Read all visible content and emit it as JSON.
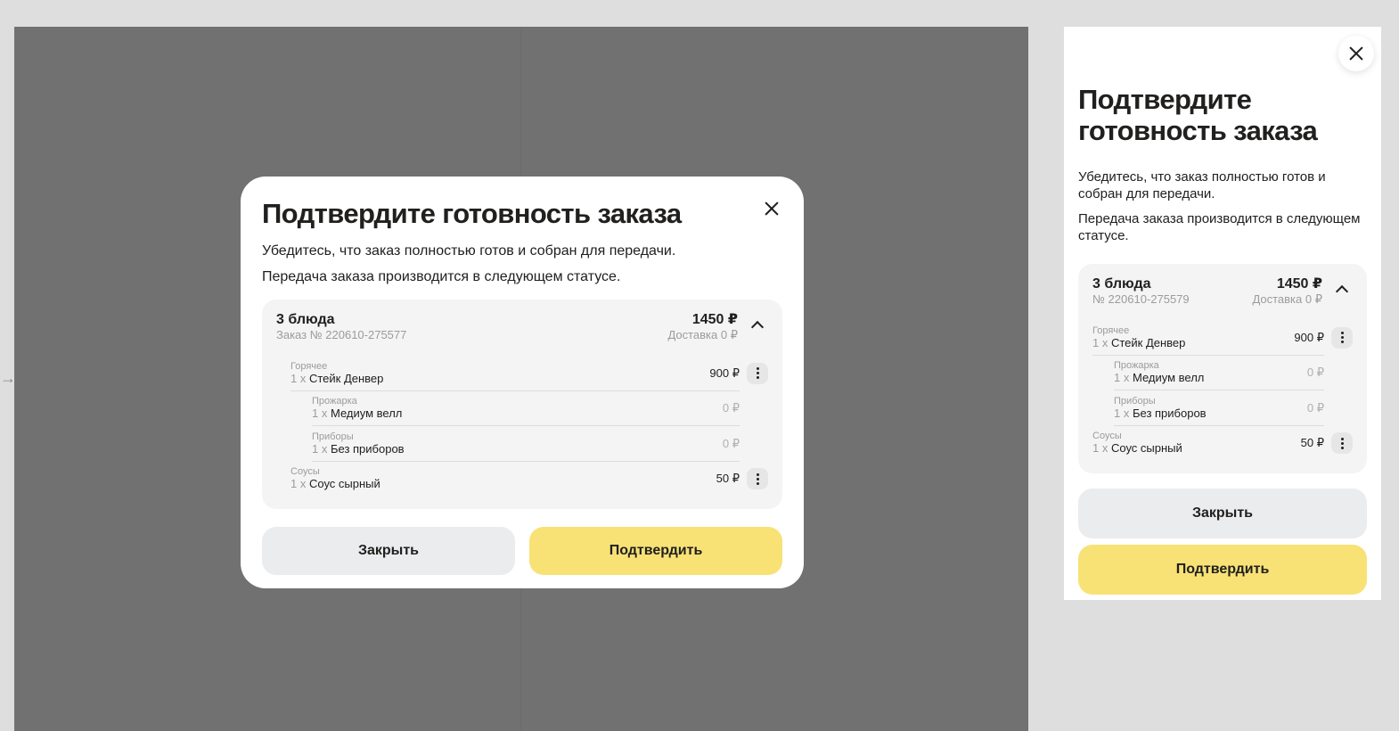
{
  "side_arrow": "→",
  "desktop": {
    "title": "Подтвердите готовность заказа",
    "description_1": "Убедитесь, что заказ полностью готов и собран для передачи.",
    "description_2": "Передача заказа производится в следующем статусе.",
    "order": {
      "dishes_count": "3 блюда",
      "order_number": "Заказ № 220610-275577",
      "total": "1450 ₽",
      "delivery": "Доставка 0 ₽",
      "items": [
        {
          "category": "Горячее",
          "qty": "1 x",
          "name": "Стейк Денвер",
          "price": "900 ₽"
        },
        {
          "category": "Прожарка",
          "qty": "1 x",
          "name": "Медиум велл",
          "price": "0 ₽"
        },
        {
          "category": "Приборы",
          "qty": "1 x",
          "name": "Без приборов",
          "price": "0 ₽"
        },
        {
          "category": "Соусы",
          "qty": "1 x",
          "name": "Соус сырный",
          "price": "50 ₽"
        }
      ]
    },
    "close_label": "Закрыть",
    "confirm_label": "Подтвердить"
  },
  "mobile": {
    "title": "Подтвердите готовность заказа",
    "description_1": "Убедитесь, что заказ полностью готов и собран для передачи.",
    "description_2": "Передача заказа производится в следующем статусе.",
    "order": {
      "dishes_count": "3 блюда",
      "order_number": "№ 220610-275579",
      "total": "1450 ₽",
      "delivery": "Доставка 0 ₽",
      "items": [
        {
          "category": "Горячее",
          "qty": "1 x",
          "name": "Стейк Денвер",
          "price": "900 ₽"
        },
        {
          "category": "Прожарка",
          "qty": "1 x",
          "name": "Медиум велл",
          "price": "0 ₽"
        },
        {
          "category": "Приборы",
          "qty": "1 x",
          "name": "Без приборов",
          "price": "0 ₽"
        },
        {
          "category": "Соусы",
          "qty": "1 x",
          "name": "Соус сырный",
          "price": "50 ₽"
        }
      ]
    },
    "close_label": "Закрыть",
    "confirm_label": "Подтвердить"
  },
  "colors": {
    "overlay": "#717171",
    "canvas": "#dedede",
    "confirm_button": "#f8e276",
    "close_button": "#ebeced",
    "order_card": "#f4f4f5"
  }
}
